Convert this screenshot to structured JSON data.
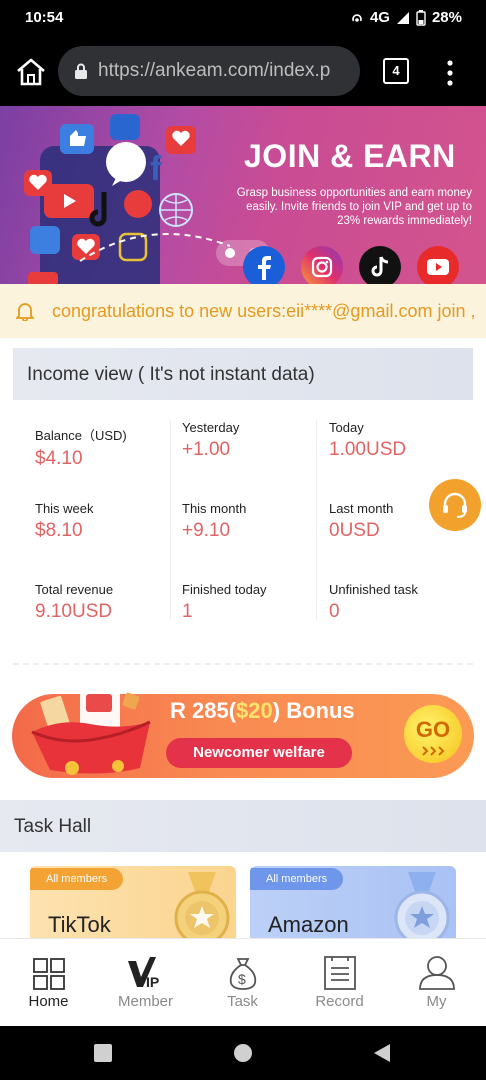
{
  "status_bar": {
    "time": "10:54",
    "network": "4G",
    "battery": "28%"
  },
  "browser": {
    "url": "https://ankeam.com/index.p",
    "tab_count": "4"
  },
  "banner": {
    "title": "JOIN & EARN",
    "subtitle": "Grasp business opportunities and earn money easily. Invite friends to join VIP and get up to 23% rewards immediately!"
  },
  "notice": {
    "text": "congratulations to new users:eii****@gmail.com join ,"
  },
  "income": {
    "title": "Income view ( It's not instant data)",
    "stats": [
      {
        "label": "Balance（USD)",
        "value": "$4.10"
      },
      {
        "label": "Yesterday",
        "value": "+1.00"
      },
      {
        "label": "Today",
        "value": "1.00USD"
      },
      {
        "label": "This week",
        "value": "$8.10"
      },
      {
        "label": "This month",
        "value": "+9.10"
      },
      {
        "label": "Last month",
        "value": "0USD"
      },
      {
        "label": "Total revenue",
        "value": "9.10USD"
      },
      {
        "label": "Finished today",
        "value": "1"
      },
      {
        "label": "Unfinished task",
        "value": "0"
      }
    ]
  },
  "bonus": {
    "title_prefix": "R 285(",
    "title_highlight": "$20",
    "title_suffix": ") Bonus",
    "welfare": "Newcomer welfare",
    "go": "GO"
  },
  "task_hall": {
    "title": "Task Hall",
    "cards": [
      {
        "badge": "All members",
        "name": "TikTok"
      },
      {
        "badge": "All members",
        "name": "Amazon"
      }
    ]
  },
  "nav": {
    "items": [
      {
        "label": "Home",
        "icon": "home-grid-icon",
        "active": true
      },
      {
        "label": "Member",
        "icon": "vip-icon",
        "active": false
      },
      {
        "label": "Task",
        "icon": "money-bag-icon",
        "active": false
      },
      {
        "label": "Record",
        "icon": "document-icon",
        "active": false
      },
      {
        "label": "My",
        "icon": "user-icon",
        "active": false
      }
    ]
  },
  "colors": {
    "accent_red": "#e06464",
    "notice_text": "#e39a1f",
    "support_orange": "#f2a22c",
    "bonus_orange": "#f98a52",
    "welfare_red": "#e3324a"
  }
}
